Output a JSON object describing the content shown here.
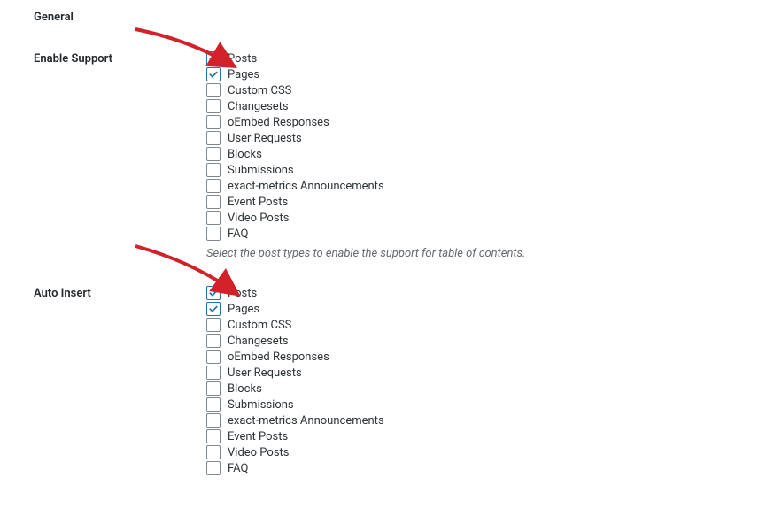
{
  "section_title": "General",
  "rows": [
    {
      "label": "Enable Support",
      "id": "enable-support",
      "options": [
        {
          "label": "Posts",
          "checked": true
        },
        {
          "label": "Pages",
          "checked": true
        },
        {
          "label": "Custom CSS",
          "checked": false
        },
        {
          "label": "Changesets",
          "checked": false
        },
        {
          "label": "oEmbed Responses",
          "checked": false
        },
        {
          "label": "User Requests",
          "checked": false
        },
        {
          "label": "Blocks",
          "checked": false
        },
        {
          "label": "Submissions",
          "checked": false
        },
        {
          "label": "exact-metrics Announcements",
          "checked": false
        },
        {
          "label": "Event Posts",
          "checked": false
        },
        {
          "label": "Video Posts",
          "checked": false
        },
        {
          "label": "FAQ",
          "checked": false
        }
      ],
      "description": "Select the post types to enable the support for table of contents."
    },
    {
      "label": "Auto Insert",
      "id": "auto-insert",
      "options": [
        {
          "label": "Posts",
          "checked": true
        },
        {
          "label": "Pages",
          "checked": true
        },
        {
          "label": "Custom CSS",
          "checked": false
        },
        {
          "label": "Changesets",
          "checked": false
        },
        {
          "label": "oEmbed Responses",
          "checked": false
        },
        {
          "label": "User Requests",
          "checked": false
        },
        {
          "label": "Blocks",
          "checked": false
        },
        {
          "label": "Submissions",
          "checked": false
        },
        {
          "label": "exact-metrics Announcements",
          "checked": false
        },
        {
          "label": "Event Posts",
          "checked": false
        },
        {
          "label": "Video Posts",
          "checked": false
        },
        {
          "label": "FAQ",
          "checked": false
        }
      ],
      "description": ""
    }
  ],
  "colors": {
    "check": "#2271b1",
    "arrow": "#d1222a"
  }
}
